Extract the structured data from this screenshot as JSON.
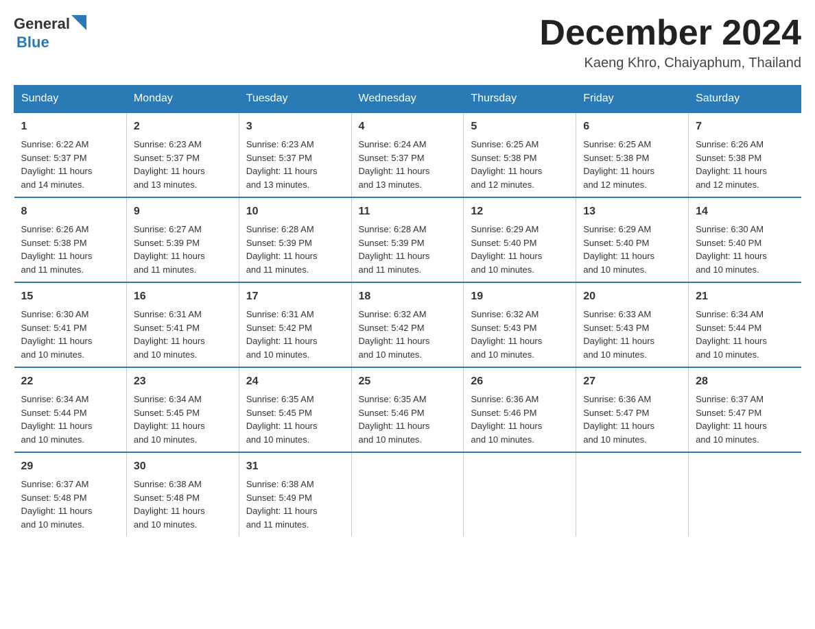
{
  "header": {
    "logo_general": "General",
    "logo_blue": "Blue",
    "month_title": "December 2024",
    "location": "Kaeng Khro, Chaiyaphum, Thailand"
  },
  "days_of_week": [
    "Sunday",
    "Monday",
    "Tuesday",
    "Wednesday",
    "Thursday",
    "Friday",
    "Saturday"
  ],
  "weeks": [
    [
      {
        "day": "1",
        "sunrise": "6:22 AM",
        "sunset": "5:37 PM",
        "daylight": "11 hours and 14 minutes."
      },
      {
        "day": "2",
        "sunrise": "6:23 AM",
        "sunset": "5:37 PM",
        "daylight": "11 hours and 13 minutes."
      },
      {
        "day": "3",
        "sunrise": "6:23 AM",
        "sunset": "5:37 PM",
        "daylight": "11 hours and 13 minutes."
      },
      {
        "day": "4",
        "sunrise": "6:24 AM",
        "sunset": "5:37 PM",
        "daylight": "11 hours and 13 minutes."
      },
      {
        "day": "5",
        "sunrise": "6:25 AM",
        "sunset": "5:38 PM",
        "daylight": "11 hours and 12 minutes."
      },
      {
        "day": "6",
        "sunrise": "6:25 AM",
        "sunset": "5:38 PM",
        "daylight": "11 hours and 12 minutes."
      },
      {
        "day": "7",
        "sunrise": "6:26 AM",
        "sunset": "5:38 PM",
        "daylight": "11 hours and 12 minutes."
      }
    ],
    [
      {
        "day": "8",
        "sunrise": "6:26 AM",
        "sunset": "5:38 PM",
        "daylight": "11 hours and 11 minutes."
      },
      {
        "day": "9",
        "sunrise": "6:27 AM",
        "sunset": "5:39 PM",
        "daylight": "11 hours and 11 minutes."
      },
      {
        "day": "10",
        "sunrise": "6:28 AM",
        "sunset": "5:39 PM",
        "daylight": "11 hours and 11 minutes."
      },
      {
        "day": "11",
        "sunrise": "6:28 AM",
        "sunset": "5:39 PM",
        "daylight": "11 hours and 11 minutes."
      },
      {
        "day": "12",
        "sunrise": "6:29 AM",
        "sunset": "5:40 PM",
        "daylight": "11 hours and 10 minutes."
      },
      {
        "day": "13",
        "sunrise": "6:29 AM",
        "sunset": "5:40 PM",
        "daylight": "11 hours and 10 minutes."
      },
      {
        "day": "14",
        "sunrise": "6:30 AM",
        "sunset": "5:40 PM",
        "daylight": "11 hours and 10 minutes."
      }
    ],
    [
      {
        "day": "15",
        "sunrise": "6:30 AM",
        "sunset": "5:41 PM",
        "daylight": "11 hours and 10 minutes."
      },
      {
        "day": "16",
        "sunrise": "6:31 AM",
        "sunset": "5:41 PM",
        "daylight": "11 hours and 10 minutes."
      },
      {
        "day": "17",
        "sunrise": "6:31 AM",
        "sunset": "5:42 PM",
        "daylight": "11 hours and 10 minutes."
      },
      {
        "day": "18",
        "sunrise": "6:32 AM",
        "sunset": "5:42 PM",
        "daylight": "11 hours and 10 minutes."
      },
      {
        "day": "19",
        "sunrise": "6:32 AM",
        "sunset": "5:43 PM",
        "daylight": "11 hours and 10 minutes."
      },
      {
        "day": "20",
        "sunrise": "6:33 AM",
        "sunset": "5:43 PM",
        "daylight": "11 hours and 10 minutes."
      },
      {
        "day": "21",
        "sunrise": "6:34 AM",
        "sunset": "5:44 PM",
        "daylight": "11 hours and 10 minutes."
      }
    ],
    [
      {
        "day": "22",
        "sunrise": "6:34 AM",
        "sunset": "5:44 PM",
        "daylight": "11 hours and 10 minutes."
      },
      {
        "day": "23",
        "sunrise": "6:34 AM",
        "sunset": "5:45 PM",
        "daylight": "11 hours and 10 minutes."
      },
      {
        "day": "24",
        "sunrise": "6:35 AM",
        "sunset": "5:45 PM",
        "daylight": "11 hours and 10 minutes."
      },
      {
        "day": "25",
        "sunrise": "6:35 AM",
        "sunset": "5:46 PM",
        "daylight": "11 hours and 10 minutes."
      },
      {
        "day": "26",
        "sunrise": "6:36 AM",
        "sunset": "5:46 PM",
        "daylight": "11 hours and 10 minutes."
      },
      {
        "day": "27",
        "sunrise": "6:36 AM",
        "sunset": "5:47 PM",
        "daylight": "11 hours and 10 minutes."
      },
      {
        "day": "28",
        "sunrise": "6:37 AM",
        "sunset": "5:47 PM",
        "daylight": "11 hours and 10 minutes."
      }
    ],
    [
      {
        "day": "29",
        "sunrise": "6:37 AM",
        "sunset": "5:48 PM",
        "daylight": "11 hours and 10 minutes."
      },
      {
        "day": "30",
        "sunrise": "6:38 AM",
        "sunset": "5:48 PM",
        "daylight": "11 hours and 10 minutes."
      },
      {
        "day": "31",
        "sunrise": "6:38 AM",
        "sunset": "5:49 PM",
        "daylight": "11 hours and 11 minutes."
      },
      null,
      null,
      null,
      null
    ]
  ],
  "labels": {
    "sunrise": "Sunrise:",
    "sunset": "Sunset:",
    "daylight": "Daylight:"
  }
}
